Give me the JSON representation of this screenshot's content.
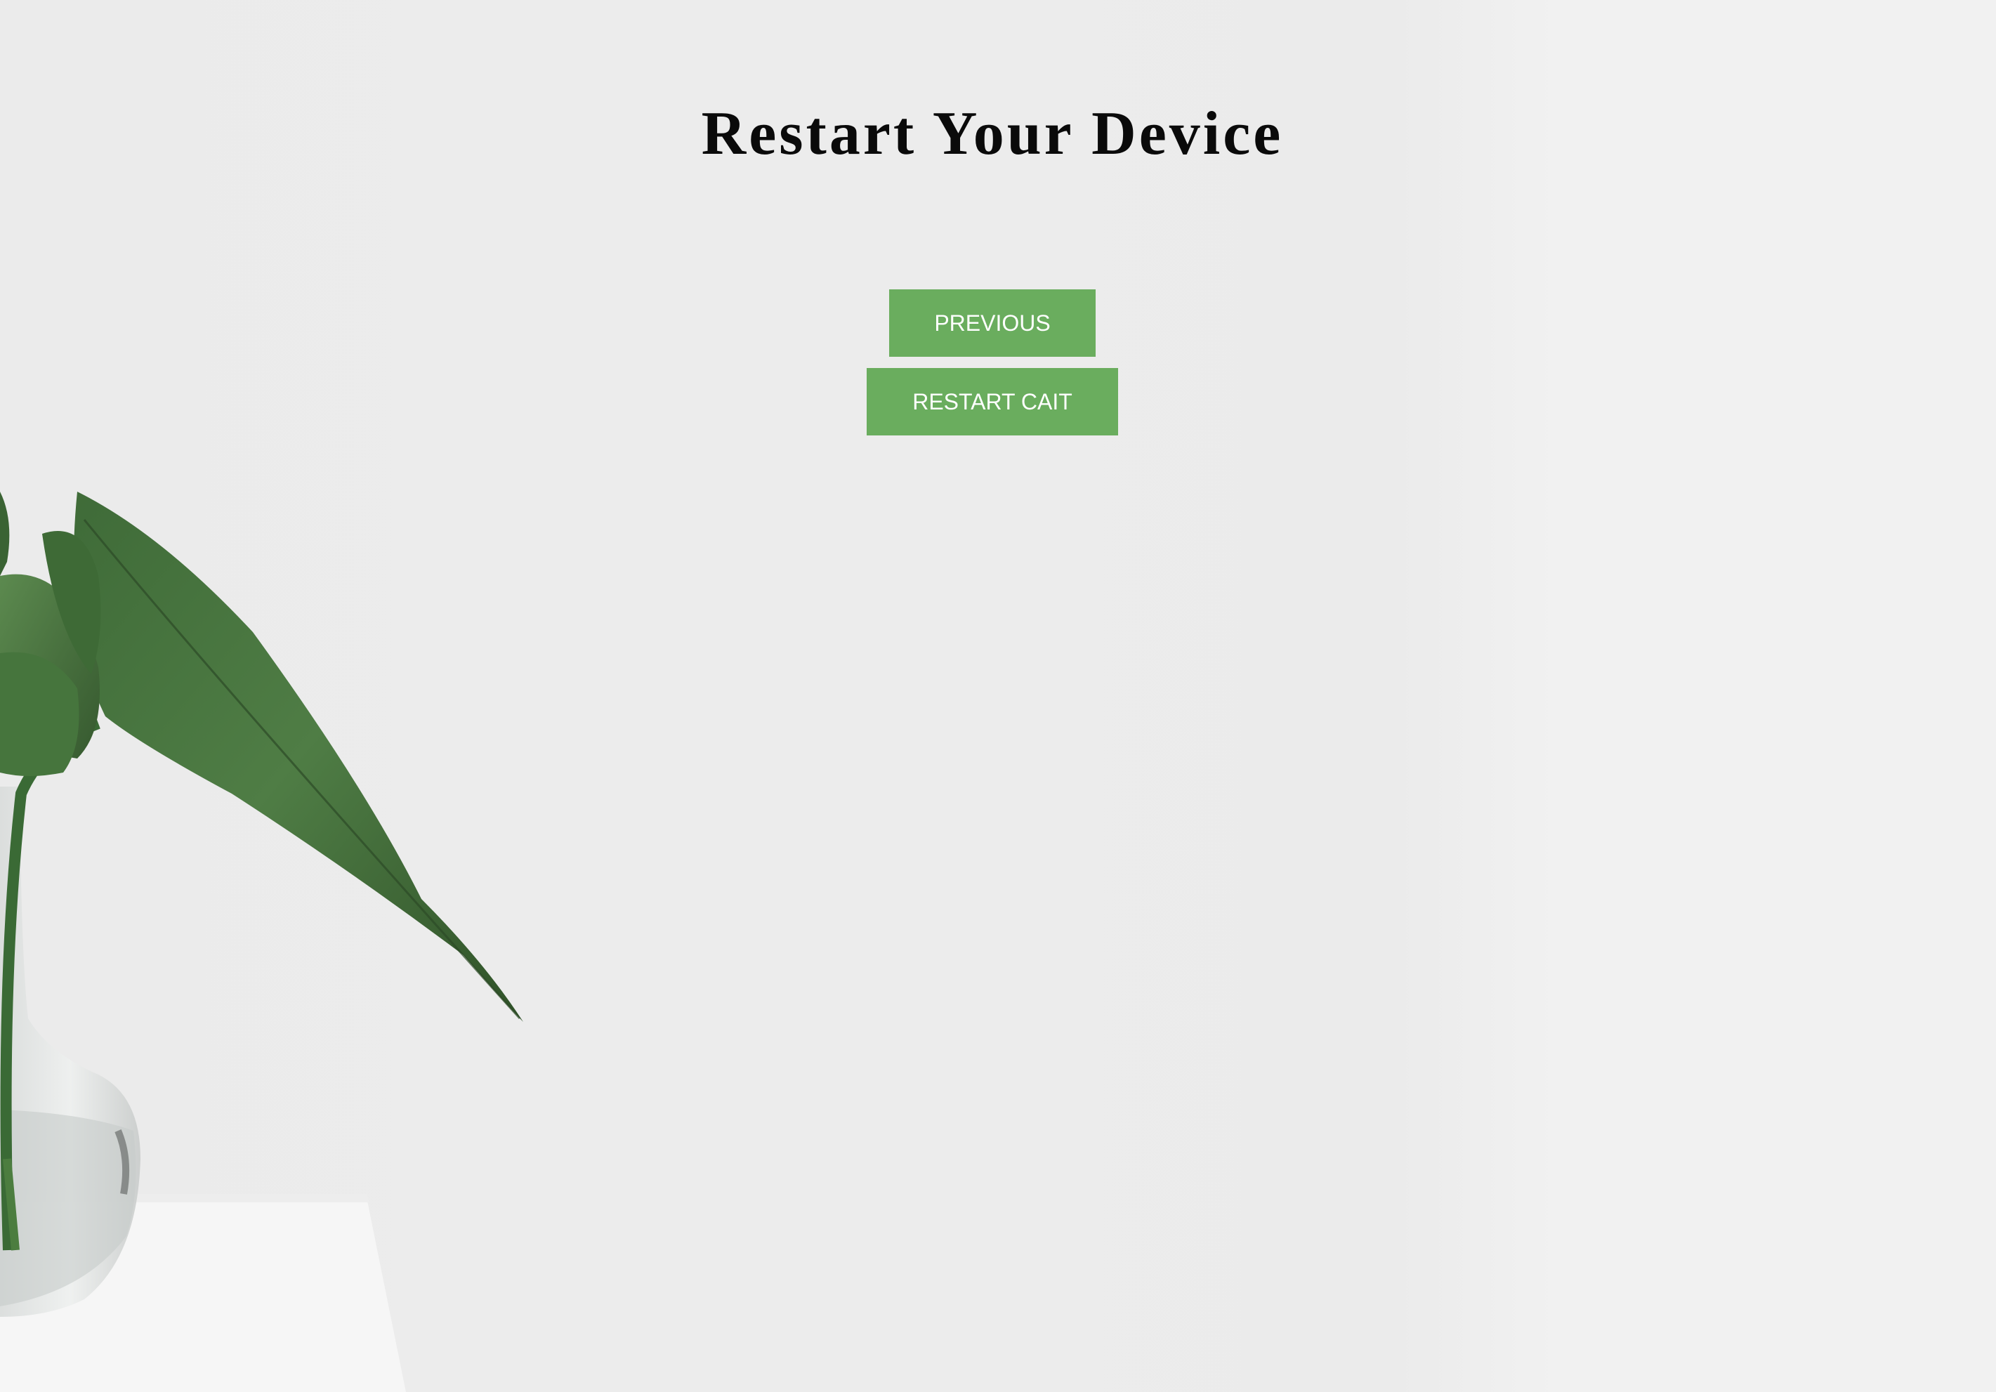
{
  "page": {
    "title": "Restart Your Device"
  },
  "buttons": {
    "previous_label": "PREVIOUS",
    "restart_label": "RESTART CAIT"
  },
  "colors": {
    "button_bg": "#6aad5e",
    "button_text": "#ffffff",
    "title_text": "#0a0a0a",
    "background": "#ececec"
  },
  "background_image": {
    "icon": "plant-in-glass-vase-photo"
  }
}
